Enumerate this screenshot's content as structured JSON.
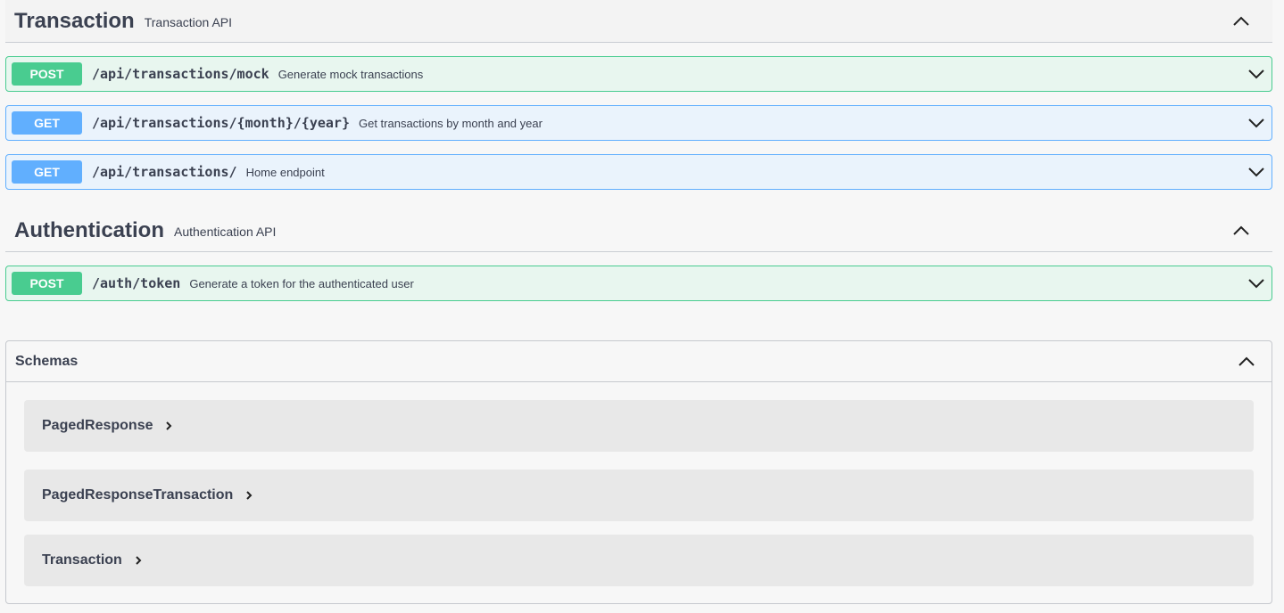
{
  "tags": [
    {
      "name": "Transaction",
      "description": "Transaction API",
      "operations": [
        {
          "method": "POST",
          "path": "/api/transactions/mock",
          "summary": "Generate mock transactions"
        },
        {
          "method": "GET",
          "path": "/api/transactions/{month}/{year}",
          "summary": "Get transactions by month and year"
        },
        {
          "method": "GET",
          "path": "/api/transactions/",
          "summary": "Home endpoint"
        }
      ]
    },
    {
      "name": "Authentication",
      "description": "Authentication API",
      "operations": [
        {
          "method": "POST",
          "path": "/auth/token",
          "summary": "Generate a token for the authenticated user"
        }
      ]
    }
  ],
  "schemas": {
    "title": "Schemas",
    "models": [
      "PagedResponse",
      "PagedResponseTransaction",
      "Transaction"
    ]
  },
  "icons": {
    "collapse": "chevron-up-icon",
    "expand": "chevron-down-icon",
    "model_expand": "chevron-right-icon"
  },
  "colors": {
    "post": "#49cc90",
    "get": "#61affe",
    "text": "#3b4151"
  }
}
